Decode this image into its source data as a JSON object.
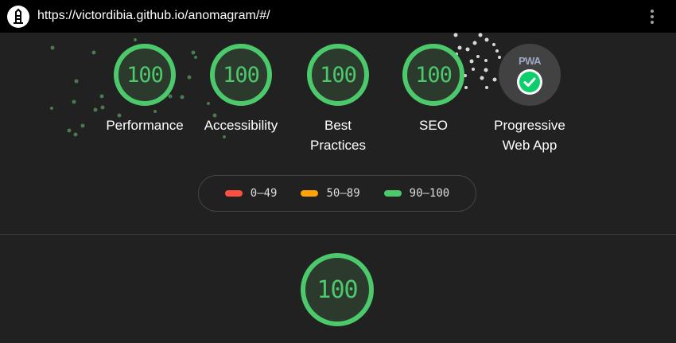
{
  "browser": {
    "url": "https://victordibia.github.io/anomagram/#/",
    "site_icon": "lighthouse-icon",
    "menu_icon": "more-vert-icon"
  },
  "colors": {
    "pass": "#4cc96a",
    "average": "#ffa400",
    "fail": "#ff4e42",
    "background": "#212121"
  },
  "gauges": [
    {
      "score": "100",
      "label": "Performance"
    },
    {
      "score": "100",
      "label": "Accessibility"
    },
    {
      "score": "100",
      "label_line1": "Best",
      "label_line2": "Practices"
    },
    {
      "score": "100",
      "label": "SEO"
    }
  ],
  "pwa": {
    "badge_text": "PWA",
    "label_line1": "Progressive",
    "label_line2": "Web App",
    "icon": "check-circle-icon"
  },
  "legend": [
    {
      "range": "0–49",
      "color": "#ff4e42"
    },
    {
      "range": "50–89",
      "color": "#ffa400"
    },
    {
      "range": "90–100",
      "color": "#4cc96a"
    }
  ],
  "main_gauge": {
    "score": "100"
  }
}
